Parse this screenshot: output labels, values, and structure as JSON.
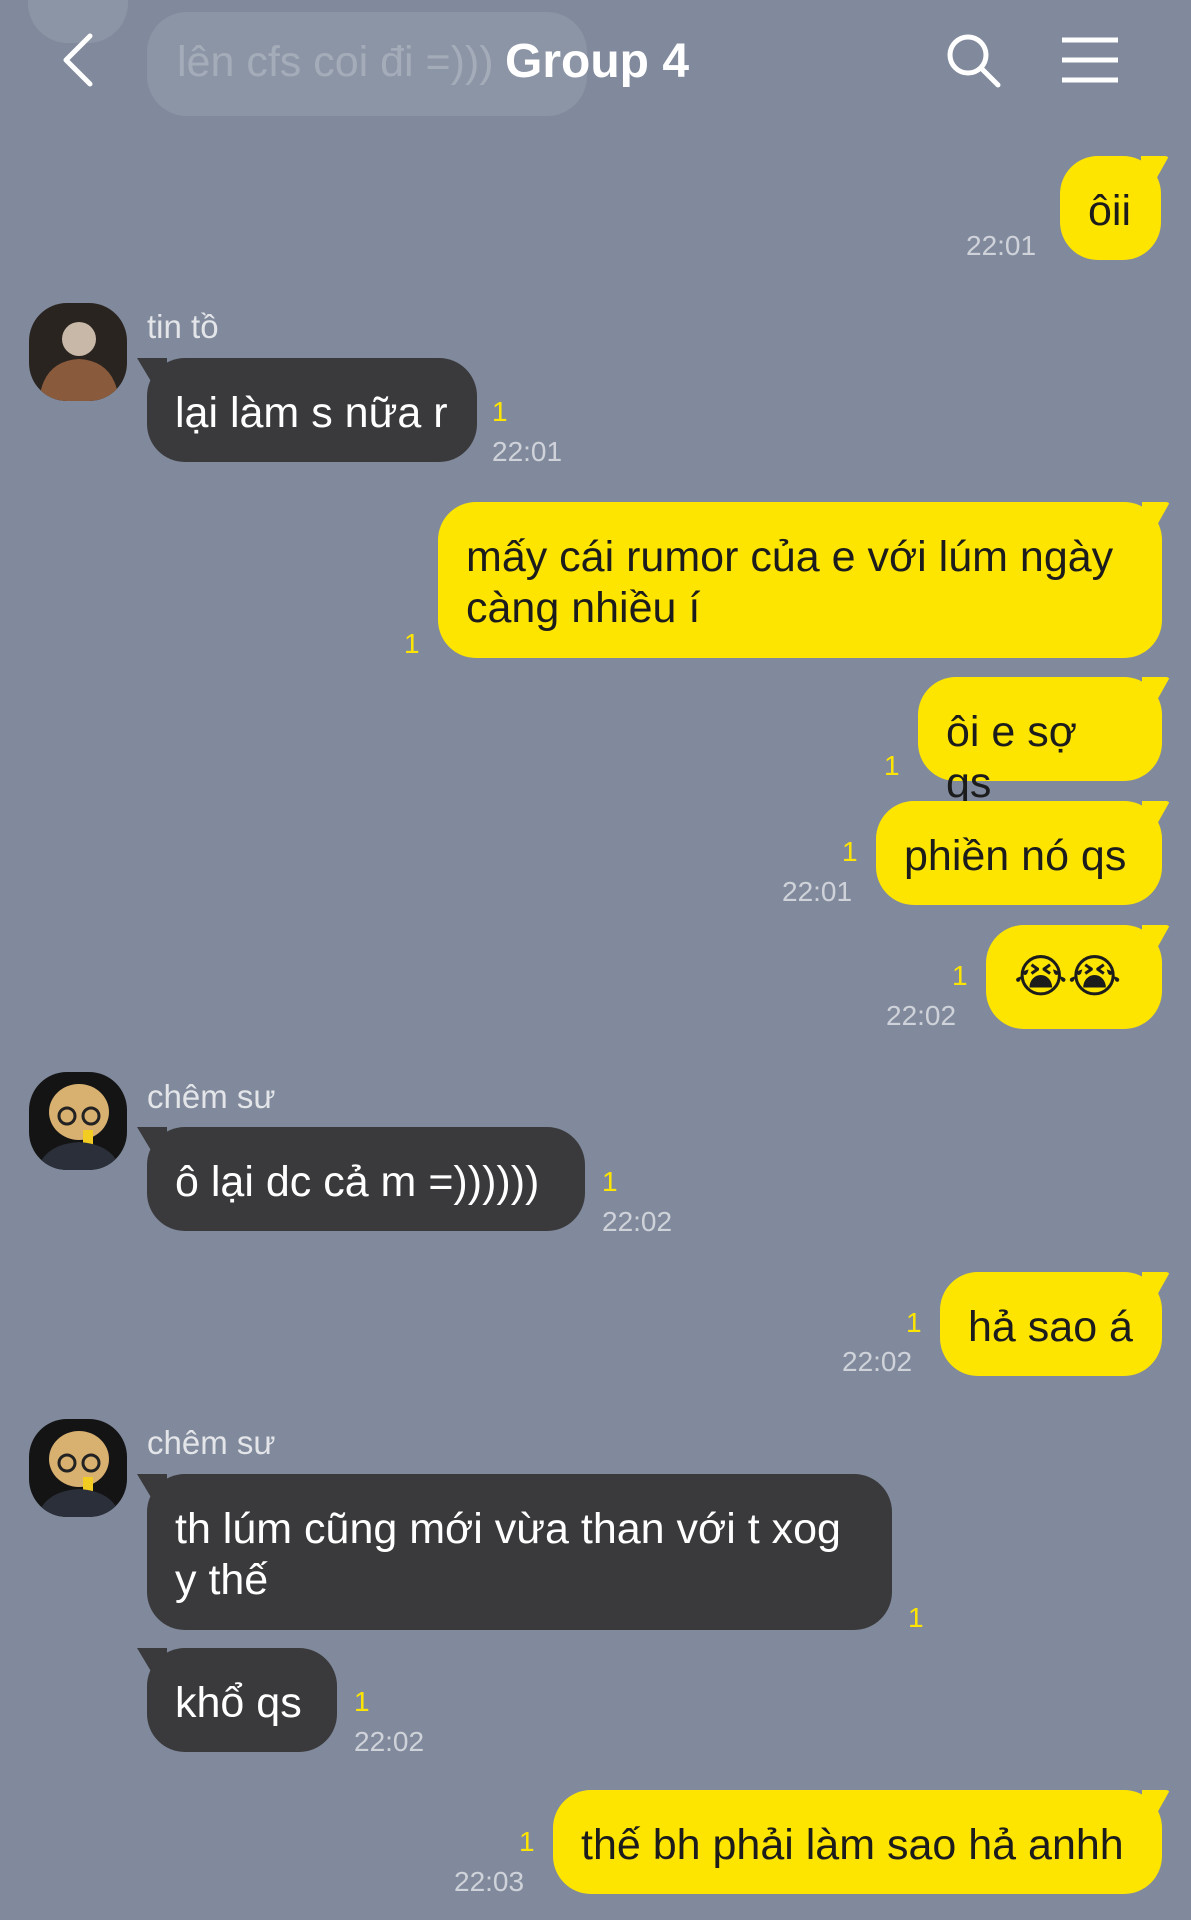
{
  "header": {
    "title": "Group 4",
    "faded_preview_text": "lên cfs coi đi =)))"
  },
  "messages": [
    {
      "text": "ôii",
      "time": "22:01"
    },
    {
      "sender": "tin tồ",
      "text": "lại làm s nữa r",
      "read": "1",
      "time": "22:01"
    },
    {
      "text": "mấy cái rumor của e với lúm ngày\ncàng nhiều í",
      "read": "1"
    },
    {
      "text": "ôi e sợ qs",
      "read": "1"
    },
    {
      "text": "phiền nó qs",
      "read": "1",
      "time": "22:01"
    },
    {
      "text": "😭😭",
      "read": "1",
      "time": "22:02"
    },
    {
      "sender": "chêm sư",
      "text": "ô lại dc cả m =))))))",
      "read": "1",
      "time": "22:02"
    },
    {
      "text": "hả sao á",
      "read": "1",
      "time": "22:02"
    },
    {
      "sender": "chêm sư",
      "text": "th lúm cũng mới vừa than với t xog\ny thế",
      "read": "1"
    },
    {
      "text": "khổ qs",
      "read": "1",
      "time": "22:02"
    },
    {
      "text": "thế bh phải làm sao hả anhh",
      "read": "1",
      "time": "22:03"
    }
  ],
  "colors": {
    "background": "#808a9c",
    "outgoing_bubble": "#fee500",
    "incoming_bubble": "#3a3a3c",
    "read_count": "#fee500"
  },
  "icons": [
    "back-arrow-icon",
    "search-icon",
    "menu-icon"
  ]
}
